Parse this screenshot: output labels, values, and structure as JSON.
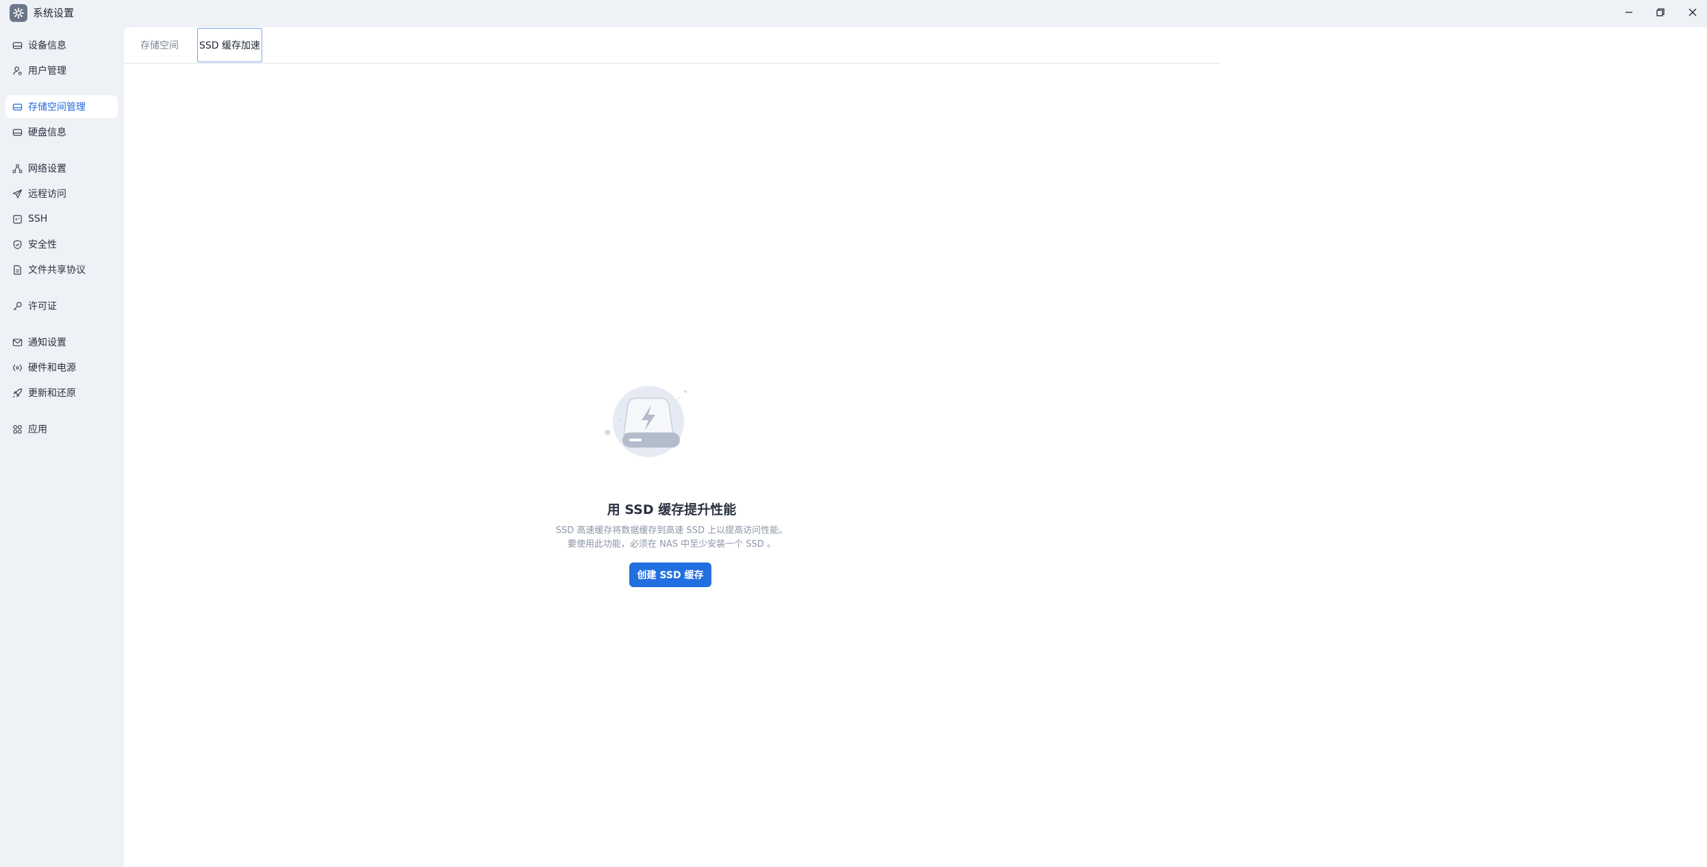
{
  "window": {
    "title": "系统设置",
    "app_icon": "gear-icon"
  },
  "sidebar": {
    "items": [
      {
        "label": "设备信息",
        "icon": "drive-icon"
      },
      {
        "label": "用户管理",
        "icon": "user-icon"
      },
      {
        "label": "存储空间管理",
        "icon": "storage-icon",
        "active": true
      },
      {
        "label": "硬盘信息",
        "icon": "disk-icon"
      },
      {
        "label": "网络设置",
        "icon": "network-icon"
      },
      {
        "label": "远程访问",
        "icon": "send-icon"
      },
      {
        "label": "SSH",
        "icon": "terminal-icon"
      },
      {
        "label": "安全性",
        "icon": "shield-icon"
      },
      {
        "label": "文件共享协议",
        "icon": "file-icon"
      },
      {
        "label": "许可证",
        "icon": "key-icon"
      },
      {
        "label": "通知设置",
        "icon": "mail-icon"
      },
      {
        "label": "硬件和电源",
        "icon": "hardware-icon"
      },
      {
        "label": "更新和还原",
        "icon": "rocket-icon"
      },
      {
        "label": "应用",
        "icon": "apps-icon"
      }
    ]
  },
  "tabs": [
    {
      "label": "存储空间"
    },
    {
      "label": "SSD 缓存加速",
      "active": true
    }
  ],
  "empty_state": {
    "title": "用 SSD 缓存提升性能",
    "desc_line1": "SSD 高速缓存将数据缓存到高速 SSD 上以提高访问性能。",
    "desc_line2": "要使用此功能，必须在 NAS 中至少安装一个 SSD 。",
    "button_label": "创建 SSD 缓存"
  },
  "colors": {
    "accent": "#2270e0",
    "sidebar_bg": "#eef1f6",
    "active_text": "#2266dd"
  }
}
